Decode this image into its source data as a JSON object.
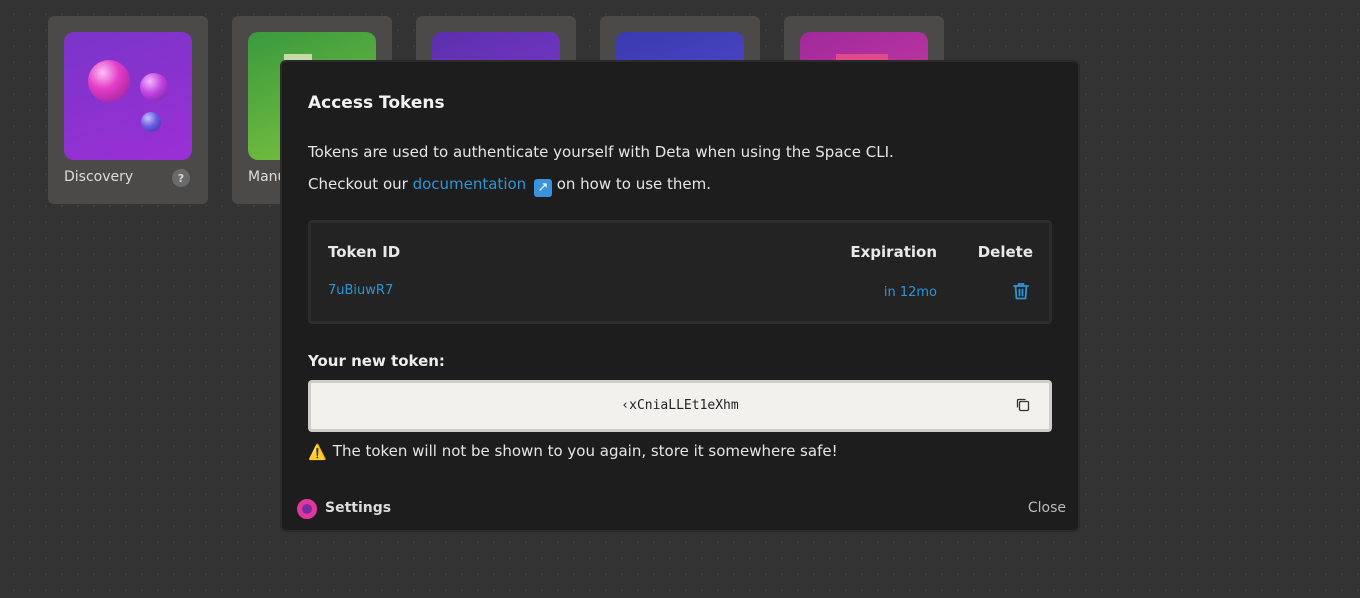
{
  "background_apps": [
    {
      "label": "Discovery",
      "help_badge": "?"
    },
    {
      "label": "Manu"
    },
    {
      "label": ""
    },
    {
      "label": ""
    },
    {
      "label": ""
    }
  ],
  "modal": {
    "title": "Access Tokens",
    "description_line1": "Tokens are used to authenticate yourself with Deta when using the Space CLI.",
    "description_line2_prefix": "Checkout our ",
    "documentation_link": "documentation",
    "external_link_icon": "↗",
    "description_line2_suffix": " on how to use them.",
    "table": {
      "headers": {
        "token_id": "Token ID",
        "expiration": "Expiration",
        "delete": "Delete"
      },
      "rows": [
        {
          "token_id": "7uBiuwR7",
          "expiration": "in 12mo"
        }
      ]
    },
    "new_token_label": "Your new token:",
    "new_token_value": "‹xCniaLLEt1eXhm",
    "warning_icon": "⚠️",
    "warning_text": "The token will not be shown to you again, store it somewhere safe!",
    "footer": {
      "settings_label": "Settings",
      "close_label": "Close"
    }
  },
  "colors": {
    "link": "#2f94d4",
    "accent_logo": "#e0389a",
    "modal_bg": "#1d1d1d"
  }
}
